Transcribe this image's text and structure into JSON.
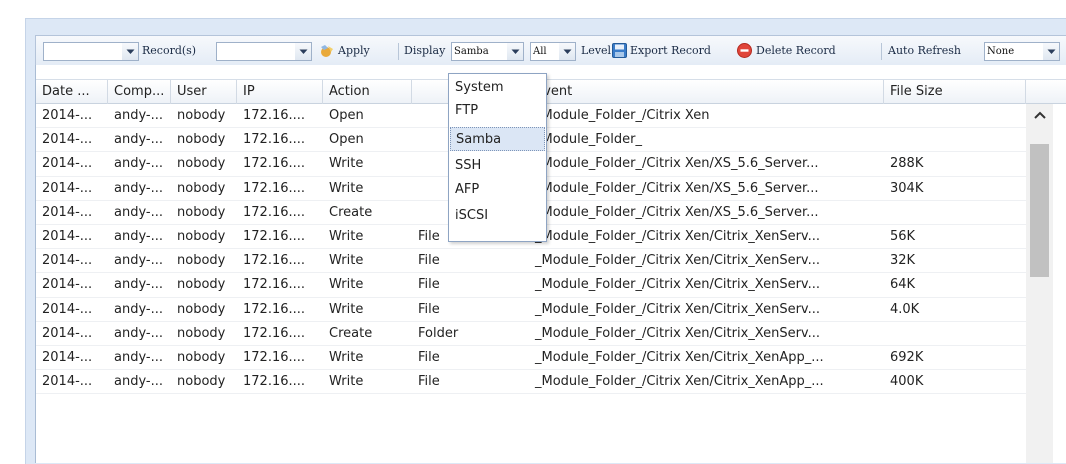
{
  "toolbar": {
    "filter_value": "",
    "records_label": "Record(s)",
    "records_value": "",
    "apply_label": "Apply",
    "display_label": "Display",
    "display_value": "Samba",
    "scope_value": "All",
    "level_label": "Level",
    "export_label": "Export Record",
    "delete_label": "Delete Record",
    "auto_refresh_label": "Auto Refresh",
    "auto_refresh_value": "None"
  },
  "columns": [
    "Date ...",
    "Comp...",
    "User",
    "IP",
    "Action",
    "",
    "Event",
    "File Size"
  ],
  "rows": [
    {
      "date": "2014-...",
      "comp": "andy-...",
      "user": "nobody",
      "ip": "172.16....",
      "action": "Open",
      "type": "",
      "event": "_Module_Folder_/Citrix Xen",
      "size": ""
    },
    {
      "date": "2014-...",
      "comp": "andy-...",
      "user": "nobody",
      "ip": "172.16....",
      "action": "Open",
      "type": "",
      "event": "_Module_Folder_",
      "size": ""
    },
    {
      "date": "2014-...",
      "comp": "andy-...",
      "user": "nobody",
      "ip": "172.16....",
      "action": "Write",
      "type": "",
      "event": "_Module_Folder_/Citrix Xen/XS_5.6_Server...",
      "size": "288K"
    },
    {
      "date": "2014-...",
      "comp": "andy-...",
      "user": "nobody",
      "ip": "172.16....",
      "action": "Write",
      "type": "",
      "event": "_Module_Folder_/Citrix Xen/XS_5.6_Server...",
      "size": "304K"
    },
    {
      "date": "2014-...",
      "comp": "andy-...",
      "user": "nobody",
      "ip": "172.16....",
      "action": "Create",
      "type": "",
      "event": "_Module_Folder_/Citrix Xen/XS_5.6_Server...",
      "size": ""
    },
    {
      "date": "2014-...",
      "comp": "andy-...",
      "user": "nobody",
      "ip": "172.16....",
      "action": "Write",
      "type": "File",
      "event": "_Module_Folder_/Citrix Xen/Citrix_XenServ...",
      "size": "56K"
    },
    {
      "date": "2014-...",
      "comp": "andy-...",
      "user": "nobody",
      "ip": "172.16....",
      "action": "Write",
      "type": "File",
      "event": "_Module_Folder_/Citrix Xen/Citrix_XenServ...",
      "size": "32K"
    },
    {
      "date": "2014-...",
      "comp": "andy-...",
      "user": "nobody",
      "ip": "172.16....",
      "action": "Write",
      "type": "File",
      "event": "_Module_Folder_/Citrix Xen/Citrix_XenServ...",
      "size": "64K"
    },
    {
      "date": "2014-...",
      "comp": "andy-...",
      "user": "nobody",
      "ip": "172.16....",
      "action": "Write",
      "type": "File",
      "event": "_Module_Folder_/Citrix Xen/Citrix_XenServ...",
      "size": "4.0K"
    },
    {
      "date": "2014-...",
      "comp": "andy-...",
      "user": "nobody",
      "ip": "172.16....",
      "action": "Create",
      "type": "Folder",
      "event": "_Module_Folder_/Citrix Xen/Citrix_XenServ...",
      "size": ""
    },
    {
      "date": "2014-...",
      "comp": "andy-...",
      "user": "nobody",
      "ip": "172.16....",
      "action": "Write",
      "type": "File",
      "event": "_Module_Folder_/Citrix Xen/Citrix_XenApp_...",
      "size": "692K"
    },
    {
      "date": "2014-...",
      "comp": "andy-...",
      "user": "nobody",
      "ip": "172.16....",
      "action": "Write",
      "type": "File",
      "event": "_Module_Folder_/Citrix Xen/Citrix_XenApp_...",
      "size": "400K"
    }
  ],
  "dropdown": {
    "options": [
      "System",
      "FTP",
      "Samba",
      "SSH",
      "AFP",
      "iSCSI"
    ],
    "selected": "Samba"
  },
  "icons": {
    "combo": "chevron-down-icon",
    "apply": "apply-icon",
    "export": "save-icon",
    "delete": "delete-icon",
    "scroll_up": "chevron-up-icon"
  },
  "colors": {
    "panel_bg": "#dde8f6",
    "selected_option_bg": "#dbe6f5",
    "delete_red": "#e0453a",
    "export_blue": "#3a7cc9"
  }
}
